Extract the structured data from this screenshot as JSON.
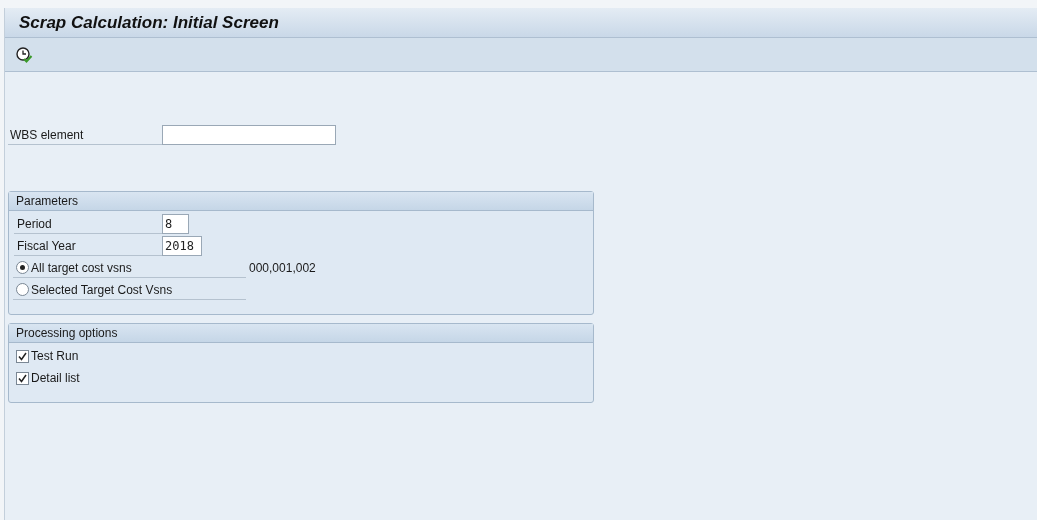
{
  "window": {
    "title": "Scrap Calculation: Initial Screen"
  },
  "toolbar": {
    "buttons": [
      {
        "kind": "execute"
      }
    ]
  },
  "wbs_field": {
    "label": "WBS element"
  },
  "parameters": {
    "title": "Parameters",
    "rows": [
      {
        "kind": "field",
        "label": "Period",
        "value": "8"
      },
      {
        "kind": "field",
        "label": "Fiscal Year",
        "value": "2018"
      },
      {
        "kind": "radio",
        "label": "All target cost vsns",
        "selected": true,
        "note": "000,001,002"
      },
      {
        "kind": "radio",
        "label": "Selected Target Cost Vsns",
        "selected": false
      }
    ]
  },
  "processing_options": {
    "title": "Processing options",
    "items": [
      {
        "label": "Test Run",
        "checked": true
      },
      {
        "label": "Detail list",
        "checked": true
      }
    ]
  }
}
